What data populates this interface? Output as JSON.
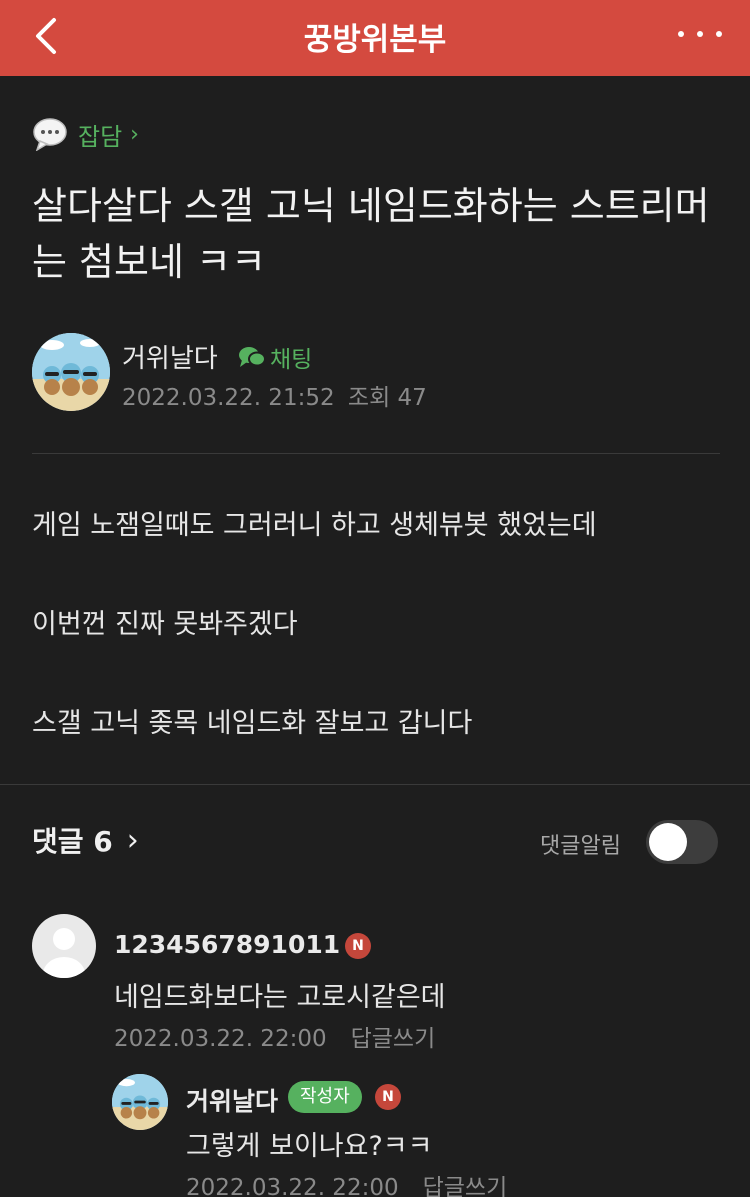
{
  "header": {
    "title": "꿍방위본부",
    "back_icon": "chevron-left-icon",
    "more_icon": "more-dots-icon",
    "color": "#d44a3f"
  },
  "post": {
    "category": "잡담",
    "category_chevron": "›",
    "title": "살다살다 스갤 고닉 네임드화하는 스트리머는 첨보네 ㅋㅋ",
    "author": "거위날다",
    "chat_label": "채팅",
    "date": "2022.03.22. 21:52",
    "views": "조회 47",
    "body": [
      "게임 노잼일때도 그러러니 하고 생체뷰봇 했었는데",
      "이번껀 진짜 못봐주겠다",
      "스갤 고닉 좆목 네임드화 잘보고 갑니다"
    ]
  },
  "comments_section": {
    "header": "댓글 6",
    "chevron": "›",
    "alarm_label": "댓글알림",
    "alarm_on": false,
    "accent": "#56b15f"
  },
  "comments": [
    {
      "name": "1234567891011",
      "badge": "N",
      "text": "네임드화보다는 고로시같은데",
      "date": "2022.03.22. 22:00",
      "reply_label": "답글쓰기"
    },
    {
      "name": "거위날다",
      "author_badge": "작성자",
      "badge": "N",
      "text": "그렇게 보이나요?ㅋㅋ",
      "date": "2022.03.22. 22:00",
      "reply_label": "답글쓰기"
    }
  ]
}
